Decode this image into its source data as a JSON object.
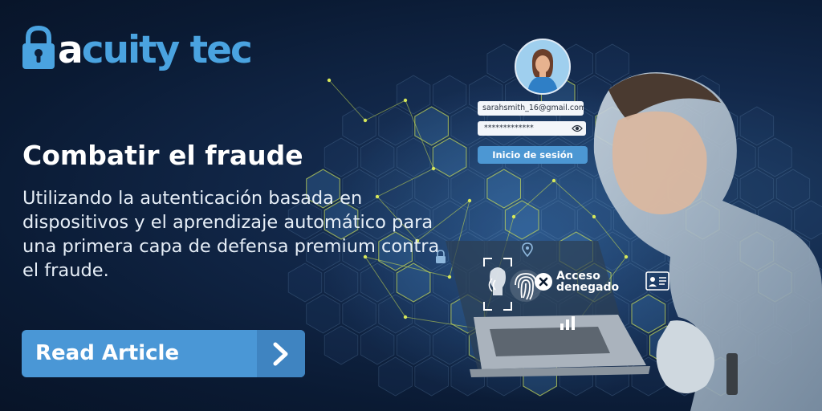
{
  "brand": {
    "logo_prefix": "a",
    "logo_name": "cuity tec",
    "colors": {
      "brand_blue": "#4aa3e0",
      "button_blue": "#4a97d6",
      "background_navy": "#0a1a33"
    }
  },
  "hero": {
    "headline": "Combatir el fraude",
    "subheadline": "Utilizando la autenticación basada en dispositivos y el aprendizaje automático para una primera capa de defensa premium contra el fraude."
  },
  "cta": {
    "label": "Read Article",
    "icon": "chevron-right-icon"
  },
  "login_widget": {
    "email": "sarahsmith_16@gmail.com",
    "password_mask": "*************",
    "login_label": "Inicio de sesión"
  },
  "biometric": {
    "status_line1": "Acceso",
    "status_line2": "denegado",
    "icons": [
      "face-scan-icon",
      "fingerprint-icon",
      "voice-wave-icon",
      "close-icon",
      "id-card-icon",
      "chart-icon",
      "lock-icon",
      "location-pin-icon"
    ]
  }
}
